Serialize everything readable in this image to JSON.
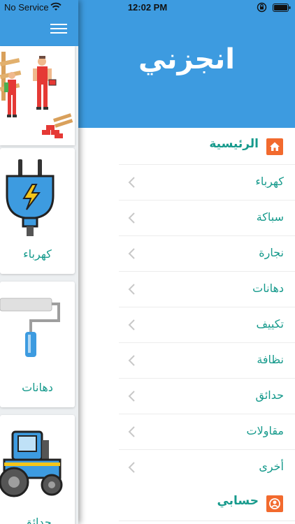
{
  "status_bar": {
    "carrier": "No Service",
    "time": "12:02 PM"
  },
  "drawer": {
    "brand_title": "انجزني",
    "home_section": {
      "label": "الرئيسية",
      "icon": "home-icon"
    },
    "menu_items": [
      {
        "label": "كهرباء"
      },
      {
        "label": "سباكة"
      },
      {
        "label": "نجارة"
      },
      {
        "label": "دهانات"
      },
      {
        "label": "تكييف"
      },
      {
        "label": "نظافة"
      },
      {
        "label": "حدائق"
      },
      {
        "label": "مقاولات"
      },
      {
        "label": "أخرى"
      }
    ],
    "account_section": {
      "label": "حسابي",
      "icon": "user-icon"
    }
  },
  "background_page": {
    "cards": [
      {
        "label": "كهرباء",
        "icon": "electric-plug-icon"
      },
      {
        "label": "دهانات",
        "icon": "paint-roller-icon"
      },
      {
        "label": "حدائق",
        "icon": "tractor-icon"
      }
    ]
  },
  "colors": {
    "primary": "#3d9be0",
    "accent_text": "#169a8c",
    "section_icon_bg": "#f26a2e"
  }
}
